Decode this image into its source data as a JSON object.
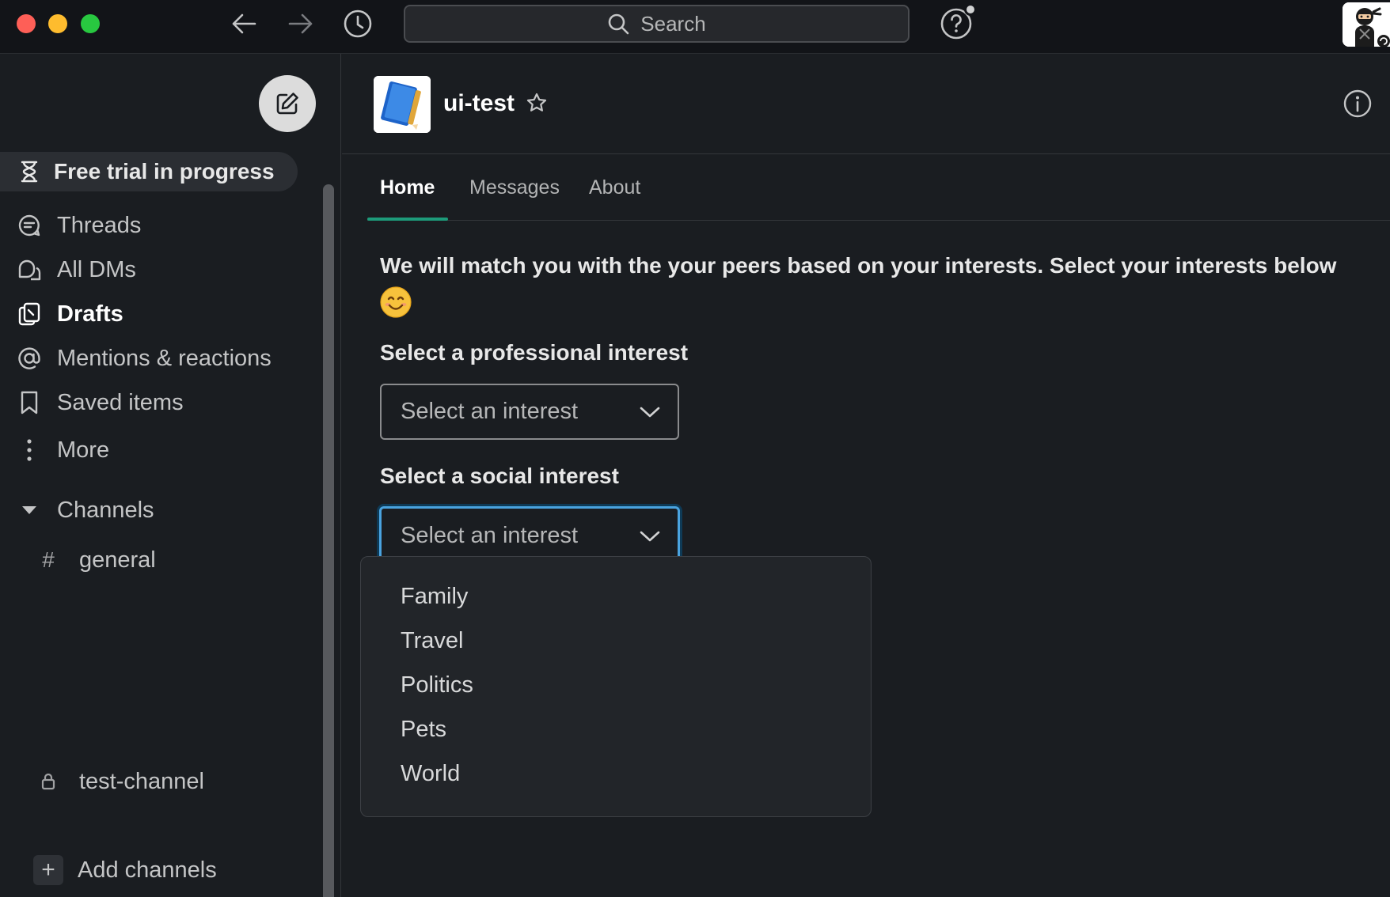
{
  "window": {
    "search_placeholder": "Search"
  },
  "sidebar": {
    "trial_label": "Free trial in progress",
    "nav": [
      {
        "label": "Threads",
        "icon": "threads-icon"
      },
      {
        "label": "All DMs",
        "icon": "dms-icon"
      },
      {
        "label": "Drafts",
        "icon": "drafts-icon",
        "active": true
      },
      {
        "label": "Mentions & reactions",
        "icon": "at-icon"
      },
      {
        "label": "Saved items",
        "icon": "bookmark-icon"
      },
      {
        "label": "More",
        "icon": "more-vertical-icon"
      }
    ],
    "channels_header": "Channels",
    "channels": [
      {
        "name": "general",
        "icon": "#"
      },
      {
        "name": "test-channel",
        "icon": "lock-icon"
      }
    ],
    "add_channels": "Add channels"
  },
  "channel": {
    "name": "ui-test",
    "tabs": [
      {
        "label": "Home",
        "active": true
      },
      {
        "label": "Messages"
      },
      {
        "label": "About"
      }
    ]
  },
  "content": {
    "intro": "We will match you with the your peers based on your interests. Select your interests below",
    "professional": {
      "label": "Select a professional interest",
      "value": "Select an interest"
    },
    "social": {
      "label": "Select a social interest",
      "value": "Select an interest"
    },
    "social_options": [
      "Family",
      "Travel",
      "Politics",
      "Pets",
      "World"
    ]
  },
  "colors": {
    "accent_tab": "#1d9b7a",
    "focus": "#4aa3df",
    "background": "#1a1d21"
  }
}
